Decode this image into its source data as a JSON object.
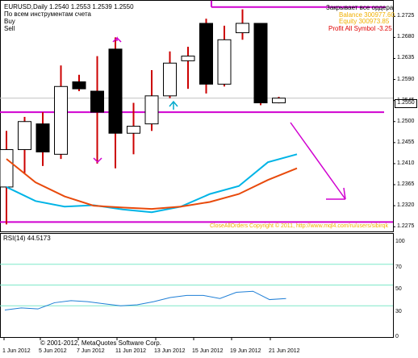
{
  "header": {
    "symbol_line": "EURUSD,Daily  1.2540 1.2553 1.2539 1.2550",
    "mode_line": "По всем инструментам счета",
    "buy_label": "Buy",
    "sell_label": "Sell"
  },
  "account_panel": {
    "close_all_label": "Закрывает все ордера",
    "balance_text": "Balance 300977.60",
    "equity_text": "Equity 300973.85",
    "profit_text": "Profit All Symbol -3.25"
  },
  "watermark": "CloseAllOrders  Copyright © 2011, http://www.mql4.com/ru/users/sibirqk",
  "copyright": "© 2001-2012, MetaQuotes Software Corp.",
  "price_scale": {
    "ticks": [
      "1.2725",
      "1.2680",
      "1.2635",
      "1.2590",
      "1.2545",
      "1.2500",
      "1.2455",
      "1.2410",
      "1.2365",
      "1.2320",
      "1.2275"
    ],
    "current_price": "1.2550"
  },
  "rsi_panel": {
    "label": "RSI(14) 44.5173",
    "levels": [
      "70",
      "50",
      "30"
    ],
    "tick_labels": [
      "100",
      "0"
    ],
    "values": [
      26,
      28,
      27,
      33,
      35,
      34,
      32,
      30,
      31,
      34,
      38,
      40,
      40,
      37,
      43,
      44,
      36,
      37
    ]
  },
  "date_axis": [
    "1 Jun 2012",
    "5 Jun 2012",
    "7 Jun 2012",
    "11 Jun 2012",
    "13 Jun 2012",
    "15 Jun 2012",
    "19 Jun 2012",
    "21 Jun 2012"
  ],
  "chart_data": {
    "type": "candlestick",
    "symbol": "EURUSD",
    "timeframe": "Daily",
    "candles": [
      {
        "o": 1.236,
        "h": 1.248,
        "l": 1.228,
        "c": 1.244
      },
      {
        "o": 1.244,
        "h": 1.251,
        "l": 1.239,
        "c": 1.25
      },
      {
        "o": 1.2495,
        "h": 1.252,
        "l": 1.2405,
        "c": 1.2435
      },
      {
        "o": 1.243,
        "h": 1.262,
        "l": 1.242,
        "c": 1.2575
      },
      {
        "o": 1.2585,
        "h": 1.26,
        "l": 1.2565,
        "c": 1.257
      },
      {
        "o": 1.2565,
        "h": 1.264,
        "l": 1.241,
        "c": 1.252
      },
      {
        "o": 1.2655,
        "h": 1.268,
        "l": 1.24,
        "c": 1.2475
      },
      {
        "o": 1.2475,
        "h": 1.254,
        "l": 1.243,
        "c": 1.249
      },
      {
        "o": 1.2495,
        "h": 1.261,
        "l": 1.248,
        "c": 1.2555
      },
      {
        "o": 1.2555,
        "h": 1.265,
        "l": 1.255,
        "c": 1.2625
      },
      {
        "o": 1.263,
        "h": 1.266,
        "l": 1.257,
        "c": 1.264
      },
      {
        "o": 1.271,
        "h": 1.272,
        "l": 1.256,
        "c": 1.258
      },
      {
        "o": 1.258,
        "h": 1.2705,
        "l": 1.2575,
        "c": 1.2675
      },
      {
        "o": 1.269,
        "h": 1.274,
        "l": 1.2675,
        "c": 1.271
      },
      {
        "o": 1.271,
        "h": 1.271,
        "l": 1.2535,
        "c": 1.254
      },
      {
        "o": 1.254,
        "h": 1.2553,
        "l": 1.2539,
        "c": 1.255
      }
    ],
    "ma_fast": [
      [
        0,
        1.236
      ],
      [
        2,
        1.233
      ],
      [
        4,
        1.2318
      ],
      [
        6,
        1.2321
      ],
      [
        8,
        1.2312
      ],
      [
        10,
        1.2306
      ],
      [
        12,
        1.2318
      ],
      [
        14,
        1.2345
      ],
      [
        16,
        1.2362
      ],
      [
        18,
        1.2413
      ],
      [
        20,
        1.243
      ]
    ],
    "ma_slow": [
      [
        0,
        1.242
      ],
      [
        2,
        1.237
      ],
      [
        4,
        1.234
      ],
      [
        6,
        1.232
      ],
      [
        8,
        1.2316
      ],
      [
        10,
        1.2313
      ],
      [
        12,
        1.2318
      ],
      [
        14,
        1.2328
      ],
      [
        16,
        1.2345
      ],
      [
        18,
        1.2375
      ],
      [
        20,
        1.24
      ]
    ],
    "lines": {
      "resistance": 1.2745,
      "support_entry": 1.252,
      "bottom": 1.2285
    },
    "ylim": [
      1.2265,
      1.276
    ],
    "colors": {
      "bull_fill": "#ffffff",
      "bear_fill": "#000000",
      "wick": "#cc0000",
      "ma_fast": "#00b4e6",
      "ma_slow": "#e84a0c",
      "levels": "#d000d0",
      "rsi_line": "#1f7fd6",
      "rsi_levels": "#7ee8c8",
      "profit_text": "#e00000",
      "watermark": "#f0b000"
    }
  }
}
